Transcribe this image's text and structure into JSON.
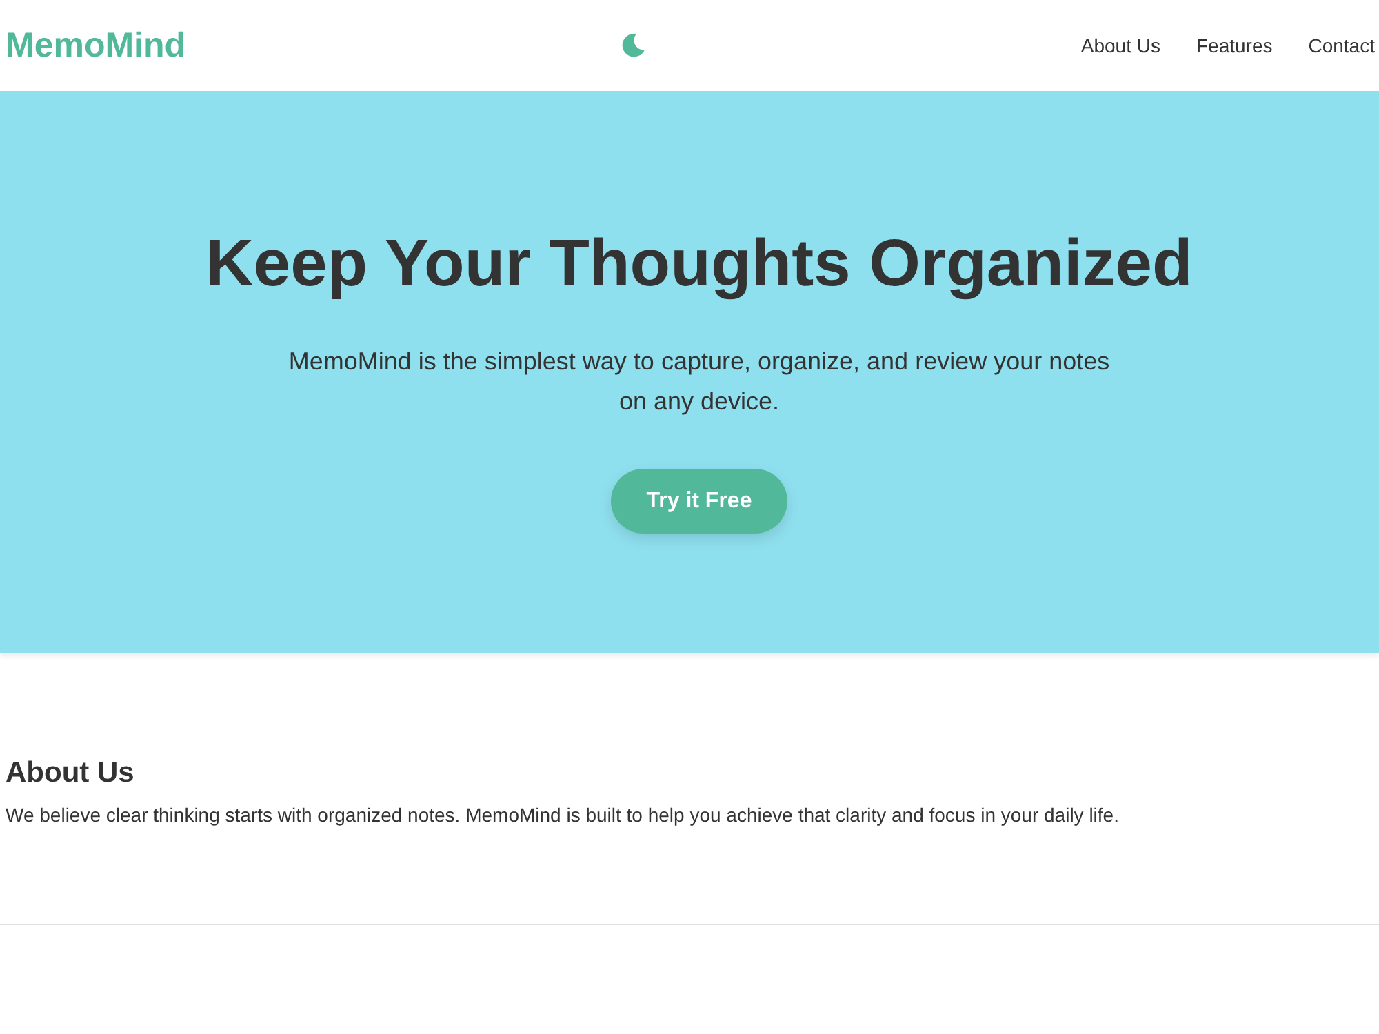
{
  "header": {
    "logo": "MemoMind",
    "nav": [
      {
        "label": "About Us"
      },
      {
        "label": "Features"
      },
      {
        "label": "Contact"
      }
    ]
  },
  "hero": {
    "title": "Keep Your Thoughts Organized",
    "subtitle": "MemoMind is the simplest way to capture, organize, and review your notes on any device.",
    "cta": "Try it Free"
  },
  "sections": [
    {
      "heading": "About Us",
      "text": "We believe clear thinking starts with organized notes. MemoMind is built to help you achieve that clarity and focus in your daily life."
    }
  ]
}
